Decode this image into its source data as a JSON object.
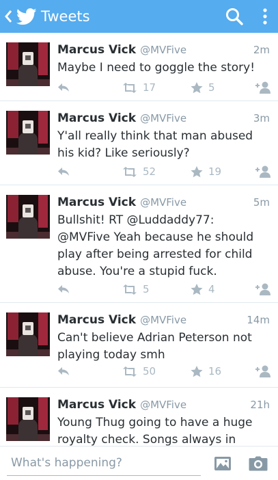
{
  "header": {
    "title": "Tweets"
  },
  "tweets": [
    {
      "name": "Marcus Vick",
      "handle": "@MVFive",
      "time": "2m",
      "text": "Maybe I need to goggle the story!",
      "retweets": "17",
      "favorites": "5"
    },
    {
      "name": "Marcus Vick",
      "handle": "@MVFive",
      "time": "3m",
      "text": "Y'all really think that man abused his kid? Like seriously?",
      "retweets": "52",
      "favorites": "19"
    },
    {
      "name": "Marcus Vick",
      "handle": "@MVFive",
      "time": "5m",
      "text": "Bullshit! RT @Luddaddy77: @MVFive Yeah because he should play after being arrested for child abuse.  You're a stupid fuck.",
      "retweets": "5",
      "favorites": "4"
    },
    {
      "name": "Marcus Vick",
      "handle": "@MVFive",
      "time": "14m",
      "text": "Can't believe Adrian Peterson not playing today smh",
      "retweets": "50",
      "favorites": "16"
    },
    {
      "name": "Marcus Vick",
      "handle": "@MVFive",
      "time": "21h",
      "text": "Young Thug going to have a huge royalty check. Songs always in",
      "retweets": "",
      "favorites": ""
    }
  ],
  "composer": {
    "placeholder": "What's happening?"
  },
  "colors": {
    "header": "#55acee",
    "muted": "#8899a6",
    "icon": "#aab8c2",
    "text": "#292f33"
  }
}
